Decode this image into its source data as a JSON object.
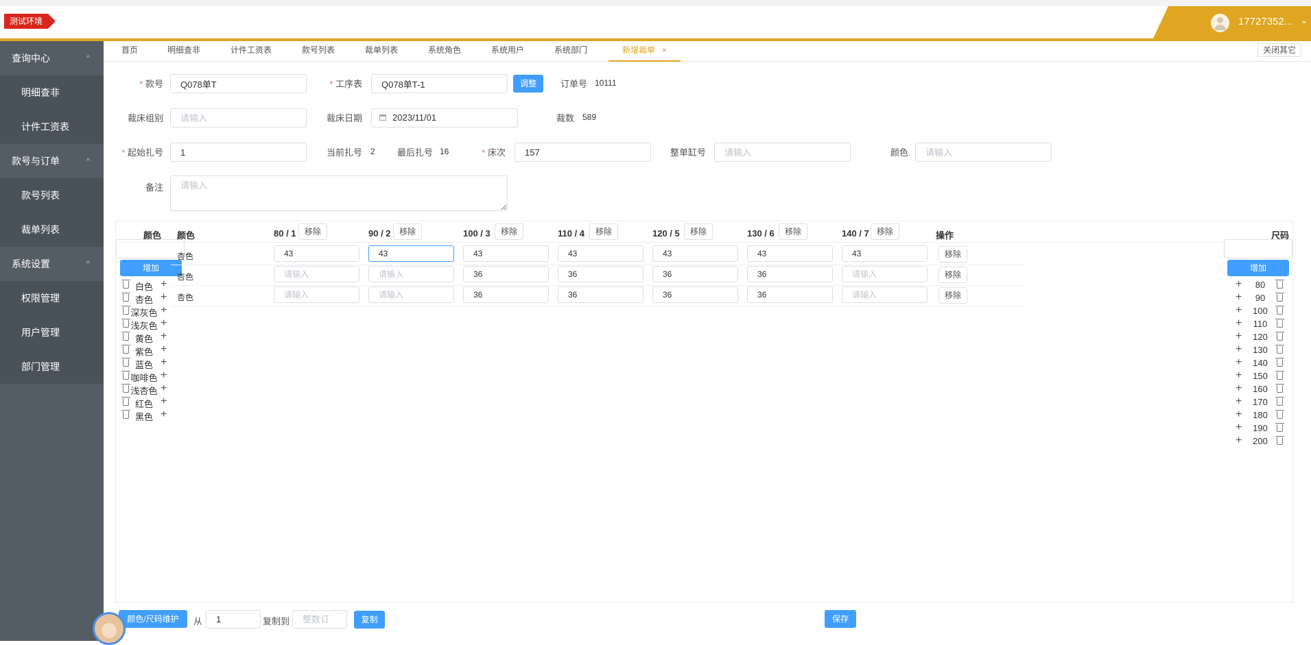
{
  "env_tag": "测试环境",
  "user": {
    "name": "17727352...",
    "chevron": "⌄"
  },
  "sidebar": [
    {
      "label": "查询中心",
      "expanded_icon": "^",
      "items": [
        "明细查非",
        "计件工资表"
      ]
    },
    {
      "label": "款号与订单",
      "expanded_icon": "^",
      "items": [
        "款号列表",
        "裁单列表"
      ]
    },
    {
      "label": "系统设置",
      "expanded_icon": "^",
      "items": [
        "权限管理",
        "用户管理",
        "部门管理"
      ]
    }
  ],
  "tabs": [
    "首页",
    "明细查非",
    "计件工资表",
    "款号列表",
    "裁单列表",
    "系统角色",
    "系统用户",
    "系统部门",
    "新增裁单"
  ],
  "active_tab_close": "×",
  "close_others": "关闭其它",
  "form": {
    "style_no": {
      "label": "款号",
      "value": "Q078单T"
    },
    "process_sheet": {
      "label": "工序表",
      "value": "Q078单T-1"
    },
    "adjust_btn": "调整",
    "order_no": {
      "label": "订单号",
      "value": "10111"
    },
    "cut_group": {
      "label": "裁床组别",
      "placeholder": "请输入"
    },
    "cut_date": {
      "label": "裁床日期",
      "value": "2023/11/01"
    },
    "cut_count": {
      "label": "裁数",
      "value": "589"
    },
    "start_bundle": {
      "label": "起始扎号",
      "value": "1"
    },
    "current_bundle": {
      "label": "当前扎号",
      "value": "2"
    },
    "last_bundle": {
      "label": "最后扎号",
      "value": "16"
    },
    "bed_no": {
      "label": "床次",
      "value": "157"
    },
    "whole_cylinder": {
      "label": "整单缸号",
      "placeholder": "请输入"
    },
    "color": {
      "label": "颜色",
      "placeholder": "请输入"
    },
    "remark": {
      "label": "备注",
      "placeholder": "请输入"
    }
  },
  "color_panel": {
    "header": "颜色",
    "add_btn": "增加",
    "colors": [
      "白色",
      "杏色",
      "深灰色",
      "浅灰色",
      "黄色",
      "紫色",
      "蓝色",
      "咖啡色",
      "浅杏色",
      "红色",
      "黑色"
    ]
  },
  "size_panel": {
    "header": "尺码",
    "add_btn": "增加",
    "sizes": [
      "80",
      "90",
      "100",
      "110",
      "120",
      "130",
      "140",
      "150",
      "160",
      "170",
      "180",
      "190",
      "200"
    ]
  },
  "table": {
    "color_col": "颜色",
    "ops_col": "操作",
    "remove_label": "移除",
    "placeholder": "请输入",
    "size_cols": [
      "80 / 1",
      "90 / 2",
      "100 / 3",
      "110 / 4",
      "120 / 5",
      "130 / 6",
      "140 / 7"
    ],
    "rows": [
      {
        "color": "杏色",
        "values": [
          "43",
          "43",
          "43",
          "43",
          "43",
          "43",
          "43"
        ]
      },
      {
        "color": "杏色",
        "values": [
          "",
          "",
          "36",
          "36",
          "36",
          "36",
          ""
        ]
      },
      {
        "color": "杏色",
        "values": [
          "",
          "",
          "36",
          "36",
          "36",
          "36",
          ""
        ]
      }
    ]
  },
  "footer": {
    "maintain_btn": "颜色/尺码维护",
    "from_label": "从",
    "from_value": "1",
    "copy_to_label": "复制到",
    "copy_to_placeholder": "整数订",
    "copy_btn": "复制",
    "save_btn": "保存"
  },
  "icons": {
    "trash": "trash-icon",
    "plus": "plus-icon",
    "calendar": "calendar-icon",
    "avatar": "avatar-icon"
  },
  "colors": {
    "accent": "#e0a521",
    "sidebar": "#545c64",
    "primary": "#409eff",
    "env_tag": "#d9261c"
  }
}
